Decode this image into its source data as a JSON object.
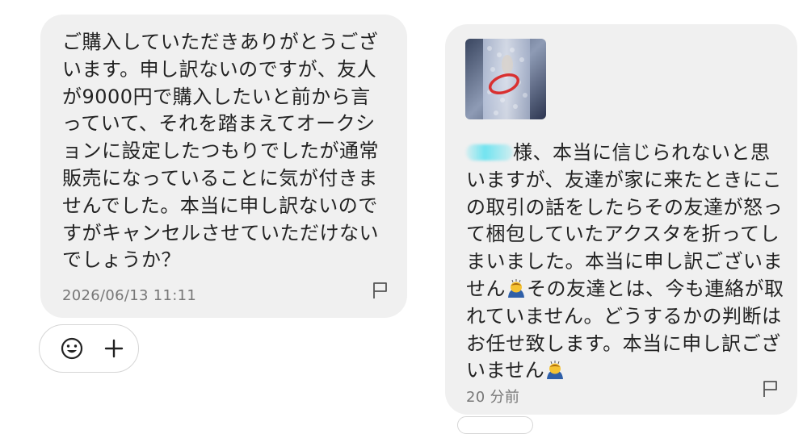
{
  "messages": [
    {
      "text": "ご購入していただきありがとうございます。申し訳ないのですが、友人が9000円で購入したいと前から言っていて、それを踏まえてオークションに設定したつもりでしたが通常販売になっていることに気が付きませんでした。本当に申し訳ないのですがキャンセルさせていただけないでしょうか？",
      "timestamp": "2026/06/13 11:11"
    },
    {
      "text_part1": "様、本当に信じられないと思いますが、友達が家に来たときにこの取引の話をしたらその友達が怒って梱包していたアクスタを折ってしまいました。本当に申し訳ございません",
      "text_part2": "その友達とは、今も連絡が取れていません。どうするかの判断はお任せ致します。本当に申し訳ございません",
      "timestamp": "20 分前"
    }
  ],
  "icons": {
    "flag": "flag-icon",
    "smile": "smile-icon",
    "plus": "plus-icon",
    "emoji": "bowing-person-emoji"
  },
  "colors": {
    "bubble": "#f0f0f0",
    "text": "#222222",
    "meta": "#777777",
    "redaction": "#5ae1f0"
  }
}
